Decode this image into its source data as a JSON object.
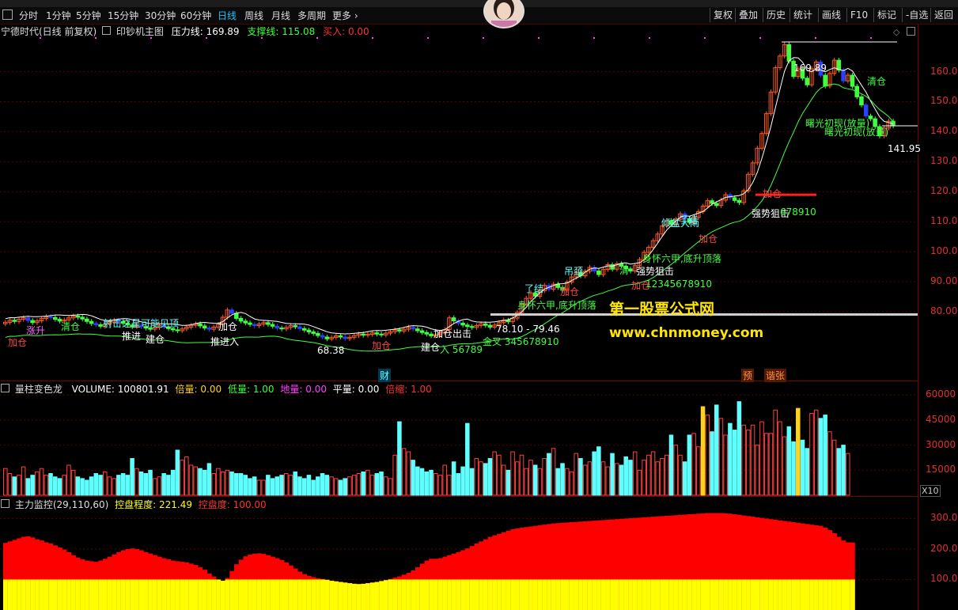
{
  "colors": {
    "up": "#ff5a1e",
    "down": "#40ff40",
    "line": "#ffffff",
    "axis": "#e03030",
    "volume_red": "#ff4040",
    "volume_cyan": "#60ffff",
    "volume_yellow": "#ffd21e",
    "control_red": "#ff0000",
    "control_yellow": "#ffff00",
    "accent": "#1ec0ff"
  },
  "period_bar": {
    "items": [
      "分时",
      "1分钟",
      "5分钟",
      "15分钟",
      "30分钟",
      "60分钟",
      "日线",
      "周线",
      "月线",
      "多周期",
      "更多 ›"
    ],
    "active": "日线",
    "right_buttons": [
      "复权",
      "叠加",
      "历史",
      "统计",
      "画线",
      "F10",
      "标记",
      "-自选",
      "返回"
    ]
  },
  "main_panel": {
    "stock": "宁德时代(日线 前复权)",
    "indicator": "印钞机主图",
    "pressure_label": "压力线:",
    "pressure_value": "169.89",
    "support_label": "支撑线:",
    "support_value": "115.08",
    "buy_label": "买入:",
    "buy_value": "0.00",
    "price_axis": [
      "160.0",
      "150.0",
      "140.0",
      "130.0",
      "120.0",
      "110.0",
      "100.0",
      "90.00",
      "80.00"
    ],
    "high_marker": "169.89",
    "last_marker": "141.95",
    "low_marker": "68.38",
    "range_marker": "78.10 - 79.46",
    "watermark_cn": "第一股票公式网",
    "watermark_url": "www.chnmoney.com",
    "event_labels": [
      "财",
      "预",
      "谐张"
    ],
    "annotations": [
      {
        "text": "加仓",
        "color": "#ff4040"
      },
      {
        "text": "涨升",
        "color": "#ff66ff"
      },
      {
        "text": "清仓",
        "color": "#40ff40"
      },
      {
        "text": "射击之星可能见顶",
        "color": "#60ffff"
      },
      {
        "text": "推进",
        "color": "#ffffff"
      },
      {
        "text": "建仓",
        "color": "#ffffff"
      },
      {
        "text": "加仓",
        "color": "#ffffff"
      },
      {
        "text": "推进入",
        "color": "#ffffff"
      },
      {
        "text": "加仓",
        "color": "#ff4040"
      },
      {
        "text": "加仓出击",
        "color": "#ffffff"
      },
      {
        "text": "建仓",
        "color": "#ffffff"
      },
      {
        "text": "入 56789",
        "color": "#40ff40"
      },
      {
        "text": "金叉 345678910",
        "color": "#40ff40"
      },
      {
        "text": "了结",
        "color": "#60ffff"
      },
      {
        "text": "身怀六甲,底升顶落",
        "color": "#40ff40"
      },
      {
        "text": "吊颈",
        "color": "#60ffff"
      },
      {
        "text": "加仓",
        "color": "#ff4040"
      },
      {
        "text": "清",
        "color": "#40ff40"
      },
      {
        "text": "强势狙击",
        "color": "#ffffff"
      },
      {
        "text": "加仓",
        "color": "#ff4040"
      },
      {
        "text": "12345678910",
        "color": "#40ff40"
      },
      {
        "text": "身怀六甲,底升顶落",
        "color": "#40ff40"
      },
      {
        "text": "倾盆大雨",
        "color": "#60ffff"
      },
      {
        "text": "了结",
        "color": "#60ffff"
      },
      {
        "text": "加仓",
        "color": "#ff4040"
      },
      {
        "text": "加仓",
        "color": "#ff4040"
      },
      {
        "text": "强势狙击",
        "color": "#ffffff"
      },
      {
        "text": "678910",
        "color": "#40ff40"
      },
      {
        "text": "清仓",
        "color": "#40ff40"
      },
      {
        "text": "曙光初现(放量)",
        "color": "#40ff40"
      },
      {
        "text": "曙光初现(放量)",
        "color": "#40ff40"
      }
    ]
  },
  "volume_panel": {
    "name": "量柱变色龙",
    "volume_label": "VOLUME:",
    "volume_value": "100801.91",
    "bei_label": "倍量:",
    "bei_value": "0.00",
    "di_label": "低量:",
    "di_value": "1.00",
    "dili_label": "地量:",
    "dili_value": "0.00",
    "ping_label": "平量:",
    "ping_value": "0.00",
    "suo_label": "倍缩:",
    "suo_value": "1.00",
    "axis": [
      "60000",
      "45000",
      "30000",
      "15000"
    ],
    "unit": "X10"
  },
  "control_panel": {
    "name": "主力监控(29,110,60)",
    "degree_label": "控盘程度:",
    "degree_value": "221.49",
    "ctrl_label": "控盘度:",
    "ctrl_value": "100.00",
    "axis": [
      "300.0",
      "200.0",
      "100.0"
    ]
  },
  "chart_data": {
    "type": "candlestick",
    "title": "宁德时代(日线 前复权)",
    "ylim": [
      60,
      172
    ],
    "closes": [
      76.5,
      77.2,
      76.8,
      77.5,
      78.0,
      77.1,
      76.4,
      77.0,
      77.8,
      78.4,
      78.1,
      77.5,
      76.9,
      77.3,
      78.0,
      78.6,
      78.2,
      77.6,
      76.8,
      76.1,
      75.7,
      75.2,
      75.9,
      76.6,
      77.2,
      76.8,
      76.2,
      75.6,
      75.0,
      75.5,
      75.1,
      74.6,
      74.2,
      74.8,
      75.4,
      75.0,
      74.4,
      74.0,
      73.7,
      74.3,
      74.9,
      75.5,
      76.0,
      75.3,
      74.6,
      74.2,
      74.9,
      75.8,
      78.2,
      80.6,
      79.5,
      77.8,
      76.9,
      76.3,
      75.8,
      75.4,
      75.9,
      76.4,
      75.8,
      75.2,
      74.6,
      74.3,
      74.8,
      75.4,
      75.0,
      74.4,
      73.9,
      73.3,
      72.8,
      72.1,
      71.6,
      71.0,
      71.5,
      72.0,
      71.6,
      71.1,
      71.5,
      72.1,
      72.6,
      72.2,
      72.5,
      73.0,
      72.6,
      72.3,
      72.9,
      73.4,
      74.0,
      73.6,
      74.2,
      74.8,
      74.3,
      73.7,
      73.1,
      72.6,
      72.0,
      72.4,
      73.0,
      74.1,
      78.0,
      77.0,
      76.2,
      75.6,
      75.1,
      74.8,
      75.4,
      76.0,
      75.5,
      74.9,
      75.6,
      76.4,
      77.2,
      76.7,
      77.9,
      79.8,
      82.6,
      84.5,
      86.3,
      85.2,
      87.0,
      88.8,
      87.5,
      89.2,
      88.1,
      87.2,
      89.9,
      91.6,
      93.1,
      92.0,
      93.5,
      94.8,
      93.6,
      92.4,
      94.1,
      95.7,
      94.2,
      96.0,
      95.2,
      94.3,
      93.6,
      95.4,
      97.4,
      99.8,
      101.5,
      103.7,
      105.9,
      108.6,
      110.4,
      109.1,
      110.8,
      112.6,
      111.0,
      109.8,
      111.5,
      113.4,
      115.2,
      117.0,
      116.1,
      115.4,
      117.2,
      119.0,
      118.0,
      117.1,
      116.4,
      120.3,
      125.8,
      129.6,
      134.5,
      139.4,
      146.0,
      153.2,
      161.3,
      165.2,
      169.0,
      163.5,
      158.4,
      160.9,
      157.8,
      155.6,
      161.0,
      163.2,
      158.8,
      155.2,
      159.4,
      163.8,
      160.5,
      156.9,
      158.8,
      155.1,
      151.6,
      148.9,
      145.2,
      144.3,
      141.7,
      138.6,
      141.2,
      143.5,
      141.95
    ],
    "volume": [
      16000,
      13000,
      11000,
      12000,
      17000,
      10000,
      12000,
      14000,
      16000,
      12000,
      13000,
      11000,
      10000,
      12000,
      18000,
      15000,
      11000,
      10000,
      9000,
      11000,
      13000,
      12000,
      14000,
      11000,
      10000,
      12000,
      13000,
      12000,
      22000,
      16000,
      14000,
      13000,
      15000,
      10000,
      11000,
      13000,
      12000,
      15000,
      27000,
      21000,
      23000,
      18000,
      17000,
      16000,
      15000,
      19000,
      13000,
      16000,
      14000,
      15000,
      14000,
      13000,
      13000,
      12000,
      10000,
      11000,
      9000,
      9000,
      12000,
      10000,
      11000,
      12000,
      13000,
      12000,
      14000,
      11000,
      10000,
      12000,
      9000,
      11000,
      13000,
      12000,
      11000,
      10000,
      9000,
      10000,
      11000,
      12000,
      13000,
      14000,
      15000,
      12000,
      13000,
      14000,
      11000,
      10000,
      24000,
      44000,
      28000,
      26000,
      21000,
      17000,
      16000,
      14000,
      15000,
      13000,
      12000,
      18000,
      12000,
      20000,
      13000,
      17000,
      43000,
      16000,
      22000,
      20000,
      19000,
      22000,
      26000,
      24000,
      18000,
      15000,
      26000,
      20000,
      24000,
      16000,
      21000,
      18000,
      16000,
      22000,
      25000,
      28000,
      16000,
      19000,
      16000,
      14000,
      25000,
      22000,
      18000,
      20000,
      26000,
      29000,
      20000,
      17000,
      25000,
      19000,
      18000,
      23000,
      21000,
      26000,
      15000,
      21000,
      24000,
      26000,
      20000,
      22000,
      24000,
      36000,
      30000,
      24000,
      20000,
      36000,
      37000,
      29000,
      53000,
      48000,
      38000,
      54000,
      46000,
      36000,
      43000,
      39000,
      56000,
      42000,
      39000,
      42000,
      30000,
      44000,
      37000,
      37000,
      51000,
      44000,
      35000,
      41000,
      32000,
      52000,
      33000,
      28000,
      49000,
      51000,
      46000,
      48000,
      38000,
      33000,
      28000,
      30000,
      25000
    ],
    "control_degree": [
      220,
      225,
      230,
      235,
      240,
      242,
      238,
      232,
      228,
      222,
      218,
      212,
      205,
      198,
      190,
      180,
      172,
      166,
      162,
      160,
      158,
      162,
      168,
      175,
      182,
      190,
      196,
      200,
      202,
      200,
      196,
      190,
      185,
      180,
      175,
      170,
      166,
      162,
      160,
      158,
      156,
      152,
      148,
      140,
      132,
      120,
      110,
      100,
      96,
      105,
      128,
      150,
      165,
      176,
      182,
      185,
      186,
      184,
      180,
      175,
      170,
      164,
      156,
      146,
      136,
      126,
      118,
      112,
      108,
      104,
      102,
      99,
      96,
      94,
      92,
      90,
      88,
      86,
      85,
      86,
      88,
      90,
      92,
      95,
      98,
      102,
      106,
      110,
      116,
      122,
      130,
      140,
      152,
      162,
      168,
      168,
      170,
      175,
      180,
      185,
      190,
      196,
      202,
      210,
      218,
      225,
      232,
      240,
      245,
      250,
      255,
      260,
      265,
      268,
      270,
      272,
      274,
      276,
      278,
      280,
      282,
      284,
      285,
      286,
      287,
      288,
      289,
      290,
      291,
      292,
      293,
      294,
      295,
      296,
      297,
      298,
      299,
      300,
      301,
      302,
      303,
      304,
      305,
      306,
      307,
      308,
      309,
      310,
      311,
      312,
      313,
      314,
      315,
      316,
      317,
      318,
      318,
      318,
      318,
      317,
      316,
      314,
      312,
      310,
      308,
      306,
      304,
      302,
      300,
      298,
      296,
      294,
      292,
      290,
      288,
      286,
      284,
      282,
      280,
      278,
      276,
      270,
      262,
      252,
      240,
      228,
      222,
      221.49
    ],
    "control_cap": 100
  }
}
